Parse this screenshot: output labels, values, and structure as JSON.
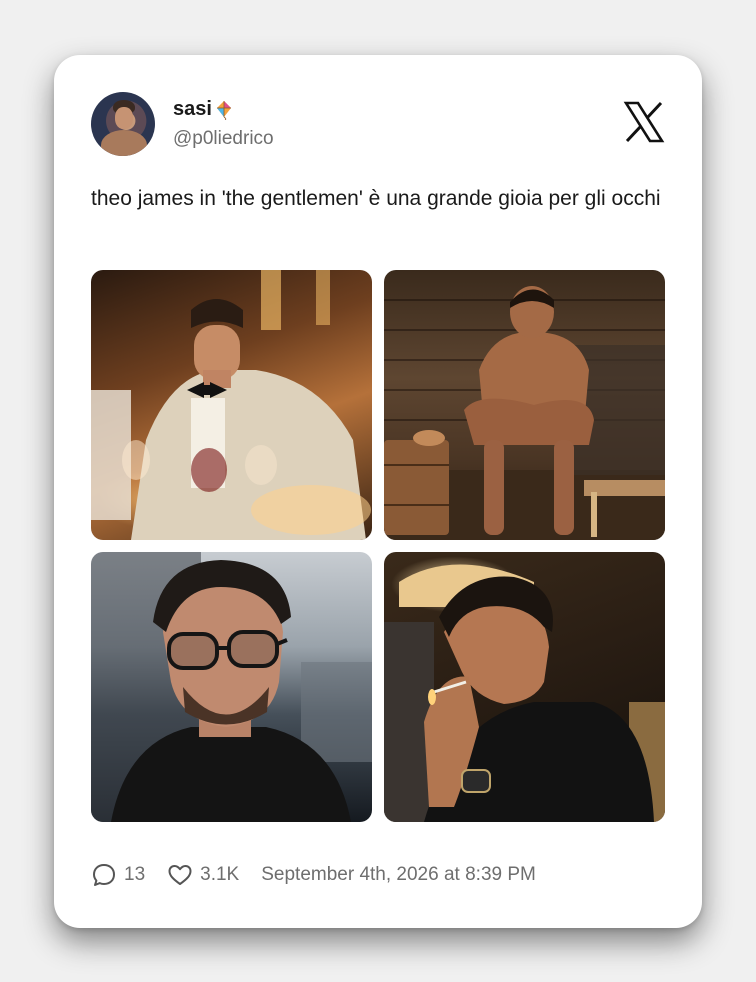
{
  "user": {
    "display_name": "sasi",
    "handle": "@p0liedrico"
  },
  "tweet": {
    "text": "theo james in 'the gentlemen' è una grande gioia per gli occhi"
  },
  "media": [
    {
      "icon": "photo"
    },
    {
      "icon": "photo"
    },
    {
      "icon": "photo"
    },
    {
      "icon": "photo"
    }
  ],
  "stats": {
    "replies": "13",
    "likes": "3.1K",
    "timestamp": "September 4th, 2026 at 8:39 PM"
  },
  "colors": {
    "text_primary": "#1a1a1a",
    "text_secondary": "#6e6e6e",
    "card_bg": "#ffffff",
    "page_bg": "#f0f0f0"
  },
  "icons": {
    "platform": "x-logo-icon",
    "reply": "speech-bubble-icon",
    "like": "heart-icon",
    "name_emoji": "kite-emoji-icon"
  }
}
